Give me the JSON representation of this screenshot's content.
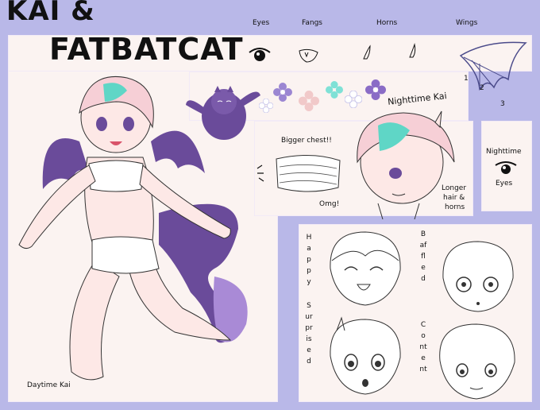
{
  "title": {
    "line1": "KAI &",
    "line2": "FATBATCAT"
  },
  "features": {
    "eyes": "Eyes",
    "fangs": "Fangs",
    "horns": "Horns",
    "wings": "Wings",
    "wing_numbers": [
      "1",
      "2",
      "3"
    ]
  },
  "labels": {
    "nighttime_kai": "Nighttime Kai",
    "bigger_chest": "Bigger chest!!",
    "omg": "Omg!",
    "longer": "Longer",
    "hair_and": "hair &",
    "horns_lbl": "horns",
    "nighttime": "Nighttime",
    "eyes2": "Eyes",
    "daytime_kai": "Daytime Kai"
  },
  "expressions": {
    "happy": "Happy",
    "surprised": "Surprised",
    "baffled": "Baffled",
    "content": "Content"
  },
  "colors": {
    "background": "#b9b8e8",
    "panel": "#fbf3f1",
    "wing_purple": "#6a4b9a",
    "hair_pink": "#f6cfd6",
    "hair_teal": "#5fd6c6",
    "tail_lilac": "#a98ad6"
  }
}
